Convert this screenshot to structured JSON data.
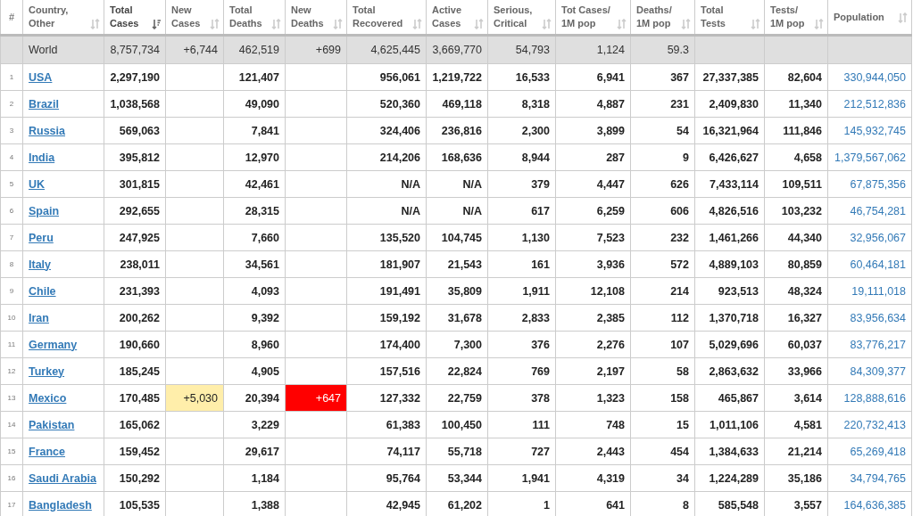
{
  "table": {
    "columns": [
      {
        "label": "#",
        "sortable": false
      },
      {
        "label": "Country,\nOther",
        "sortable": true,
        "sorted": false
      },
      {
        "label": "Total\nCases",
        "sortable": true,
        "sorted": true
      },
      {
        "label": "New\nCases",
        "sortable": true,
        "sorted": false
      },
      {
        "label": "Total\nDeaths",
        "sortable": true,
        "sorted": false
      },
      {
        "label": "New\nDeaths",
        "sortable": true,
        "sorted": false
      },
      {
        "label": "Total\nRecovered",
        "sortable": true,
        "sorted": false
      },
      {
        "label": "Active\nCases",
        "sortable": true,
        "sorted": false
      },
      {
        "label": "Serious,\nCritical",
        "sortable": true,
        "sorted": false
      },
      {
        "label": "Tot Cases/\n1M pop",
        "sortable": true,
        "sorted": false
      },
      {
        "label": "Deaths/\n1M pop",
        "sortable": true,
        "sorted": false
      },
      {
        "label": "Total\nTests",
        "sortable": true,
        "sorted": false
      },
      {
        "label": "Tests/\n1M pop",
        "sortable": true,
        "sorted": false
      },
      {
        "label": "Population",
        "sortable": true,
        "sorted": false
      }
    ],
    "rows": [
      {
        "kind": "total",
        "cells": [
          null,
          "World",
          "8,757,734",
          "+6,744",
          "462,519",
          "+699",
          "4,625,445",
          "3,669,770",
          "54,793",
          "1,124",
          "59.3",
          null,
          null,
          null
        ]
      },
      {
        "kind": "country",
        "cells": [
          "1",
          "USA",
          "2,297,190",
          null,
          "121,407",
          null,
          "956,061",
          "1,219,722",
          "16,533",
          "6,941",
          "367",
          "27,337,385",
          "82,604",
          "330,944,050"
        ]
      },
      {
        "kind": "country",
        "cells": [
          "2",
          "Brazil",
          "1,038,568",
          null,
          "49,090",
          null,
          "520,360",
          "469,118",
          "8,318",
          "4,887",
          "231",
          "2,409,830",
          "11,340",
          "212,512,836"
        ]
      },
      {
        "kind": "country",
        "cells": [
          "3",
          "Russia",
          "569,063",
          null,
          "7,841",
          null,
          "324,406",
          "236,816",
          "2,300",
          "3,899",
          "54",
          "16,321,964",
          "111,846",
          "145,932,745"
        ]
      },
      {
        "kind": "country",
        "cells": [
          "4",
          "India",
          "395,812",
          null,
          "12,970",
          null,
          "214,206",
          "168,636",
          "8,944",
          "287",
          "9",
          "6,426,627",
          "4,658",
          "1,379,567,062"
        ]
      },
      {
        "kind": "country",
        "cells": [
          "5",
          "UK",
          "301,815",
          null,
          "42,461",
          null,
          "N/A",
          "N/A",
          "379",
          "4,447",
          "626",
          "7,433,114",
          "109,511",
          "67,875,356"
        ]
      },
      {
        "kind": "country",
        "cells": [
          "6",
          "Spain",
          "292,655",
          null,
          "28,315",
          null,
          "N/A",
          "N/A",
          "617",
          "6,259",
          "606",
          "4,826,516",
          "103,232",
          "46,754,281"
        ]
      },
      {
        "kind": "country",
        "cells": [
          "7",
          "Peru",
          "247,925",
          null,
          "7,660",
          null,
          "135,520",
          "104,745",
          "1,130",
          "7,523",
          "232",
          "1,461,266",
          "44,340",
          "32,956,067"
        ]
      },
      {
        "kind": "country",
        "cells": [
          "8",
          "Italy",
          "238,011",
          null,
          "34,561",
          null,
          "181,907",
          "21,543",
          "161",
          "3,936",
          "572",
          "4,889,103",
          "80,859",
          "60,464,181"
        ]
      },
      {
        "kind": "country",
        "cells": [
          "9",
          "Chile",
          "231,393",
          null,
          "4,093",
          null,
          "191,491",
          "35,809",
          "1,911",
          "12,108",
          "214",
          "923,513",
          "48,324",
          "19,111,018"
        ]
      },
      {
        "kind": "country",
        "cells": [
          "10",
          "Iran",
          "200,262",
          null,
          "9,392",
          null,
          "159,192",
          "31,678",
          "2,833",
          "2,385",
          "112",
          "1,370,718",
          "16,327",
          "83,956,634"
        ]
      },
      {
        "kind": "country",
        "cells": [
          "11",
          "Germany",
          "190,660",
          null,
          "8,960",
          null,
          "174,400",
          "7,300",
          "376",
          "2,276",
          "107",
          "5,029,696",
          "60,037",
          "83,776,217"
        ]
      },
      {
        "kind": "country",
        "cells": [
          "12",
          "Turkey",
          "185,245",
          null,
          "4,905",
          null,
          "157,516",
          "22,824",
          "769",
          "2,197",
          "58",
          "2,863,632",
          "33,966",
          "84,309,377"
        ]
      },
      {
        "kind": "country",
        "cells": [
          "13",
          "Mexico",
          "170,485",
          "+5,030",
          "20,394",
          "+647",
          "127,332",
          "22,759",
          "378",
          "1,323",
          "158",
          "465,867",
          "3,614",
          "128,888,616"
        ]
      },
      {
        "kind": "country",
        "cells": [
          "14",
          "Pakistan",
          "165,062",
          null,
          "3,229",
          null,
          "61,383",
          "100,450",
          "111",
          "748",
          "15",
          "1,011,106",
          "4,581",
          "220,732,413"
        ]
      },
      {
        "kind": "country",
        "cells": [
          "15",
          "France",
          "159,452",
          null,
          "29,617",
          null,
          "74,117",
          "55,718",
          "727",
          "2,443",
          "454",
          "1,384,633",
          "21,214",
          "65,269,418"
        ]
      },
      {
        "kind": "country",
        "cells": [
          "16",
          "Saudi Arabia",
          "150,292",
          null,
          "1,184",
          null,
          "95,764",
          "53,344",
          "1,941",
          "4,319",
          "34",
          "1,224,289",
          "35,186",
          "34,794,765"
        ]
      },
      {
        "kind": "country",
        "cells": [
          "17",
          "Bangladesh",
          "105,535",
          null,
          "1,388",
          null,
          "42,945",
          "61,202",
          "1",
          "641",
          "8",
          "585,548",
          "3,557",
          "164,636,385"
        ]
      }
    ]
  }
}
